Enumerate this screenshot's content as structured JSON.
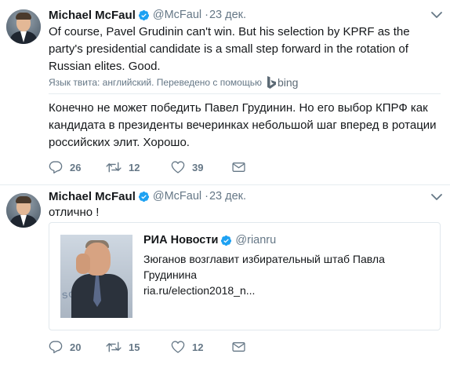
{
  "tweets": [
    {
      "author_name": "Michael McFaul",
      "handle": "@McFaul",
      "separator": "·",
      "date": "23 дек.",
      "text": "Of course, Pavel Grudinin can't win. But his selection by KPRF as the party's presidential candidate is a small step forward in the rotation of Russian elites. Good.",
      "translation_label": "Язык твита: английский. Переведено с помощью",
      "translation_provider": "bing",
      "translation": "Конечно не может победить Павел Грудинин. Но его выбор КПРФ как кандидата в президенты вечеринках небольшой шаг вперед в ротации российских элит.  Хорошо.",
      "replies": "26",
      "retweets": "12",
      "likes": "39"
    },
    {
      "author_name": "Michael McFaul",
      "handle": "@McFaul",
      "separator": "·",
      "date": "23 дек.",
      "text": "отлично !",
      "quote": {
        "author_name": "РИА Новости",
        "handle": "@rianru",
        "title": "Зюганов возглавит избирательный штаб Павла Грудинина",
        "link": "ria.ru/election2018_n..."
      },
      "replies": "20",
      "retweets": "15",
      "likes": "12"
    }
  ],
  "colors": {
    "verified": "#1da1f2",
    "secondary_text": "#657786",
    "primary_text": "#14171a",
    "border": "#e6ecf0"
  },
  "icons": [
    "verified-badge-icon",
    "chevron-down-icon",
    "reply-icon",
    "retweet-icon",
    "like-icon",
    "direct-message-icon",
    "bing-logo-icon"
  ]
}
